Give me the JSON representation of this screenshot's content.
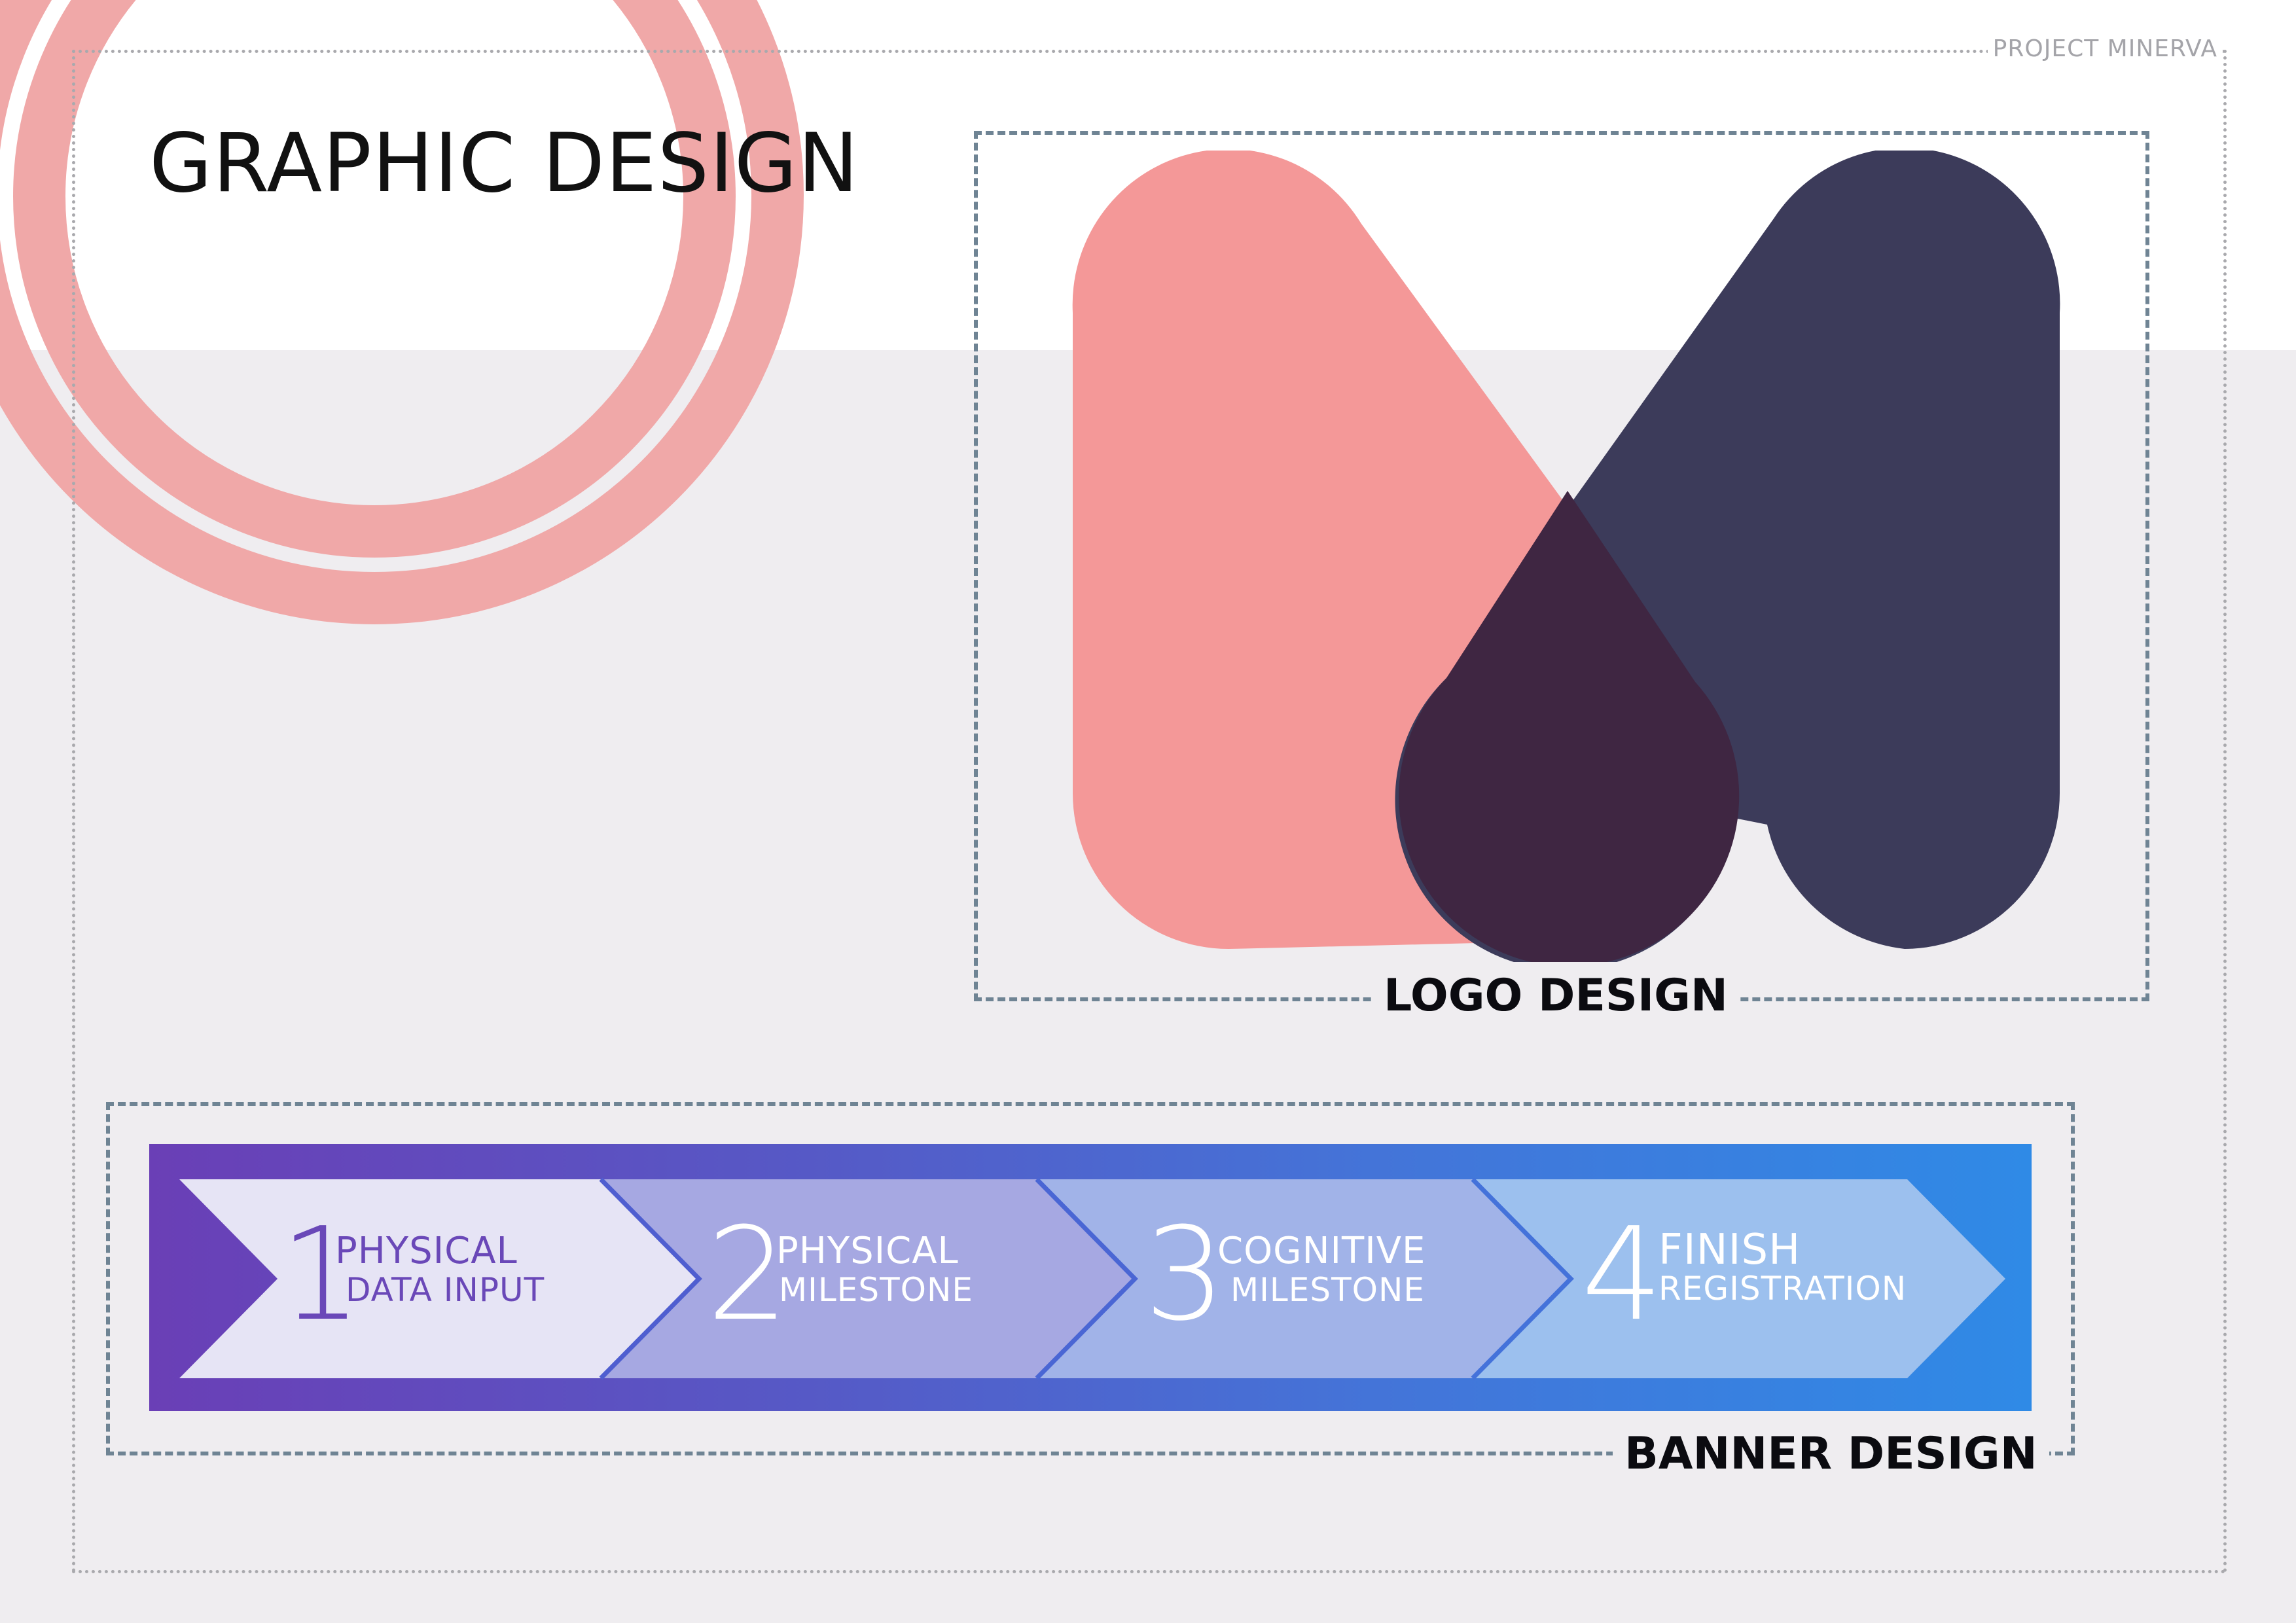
{
  "header": {
    "project_name": "PROJECT MINERVA",
    "title": "GRAPHIC DESIGN"
  },
  "logo_section": {
    "label": "LOGO DESIGN",
    "colors": {
      "left_shape": "#f49898",
      "right_shape": "#3c3b5a",
      "overlap": "#3f2642"
    }
  },
  "banner_section": {
    "label": "BANNER DESIGN",
    "steps": [
      {
        "number": "1",
        "line1": "PHYSICAL",
        "line2": "DATA INPUT"
      },
      {
        "number": "2",
        "line1": "PHYSICAL",
        "line2": "MILESTONE"
      },
      {
        "number": "3",
        "line1": "COGNITIVE",
        "line2": "MILESTONE"
      },
      {
        "number": "4",
        "line1": "FINISH",
        "line2": "REGISTRATION"
      }
    ]
  },
  "colors": {
    "accent_pink": "#f0a8a8",
    "page_grey": "#efedf0",
    "frame_dash": "#6f8494"
  }
}
